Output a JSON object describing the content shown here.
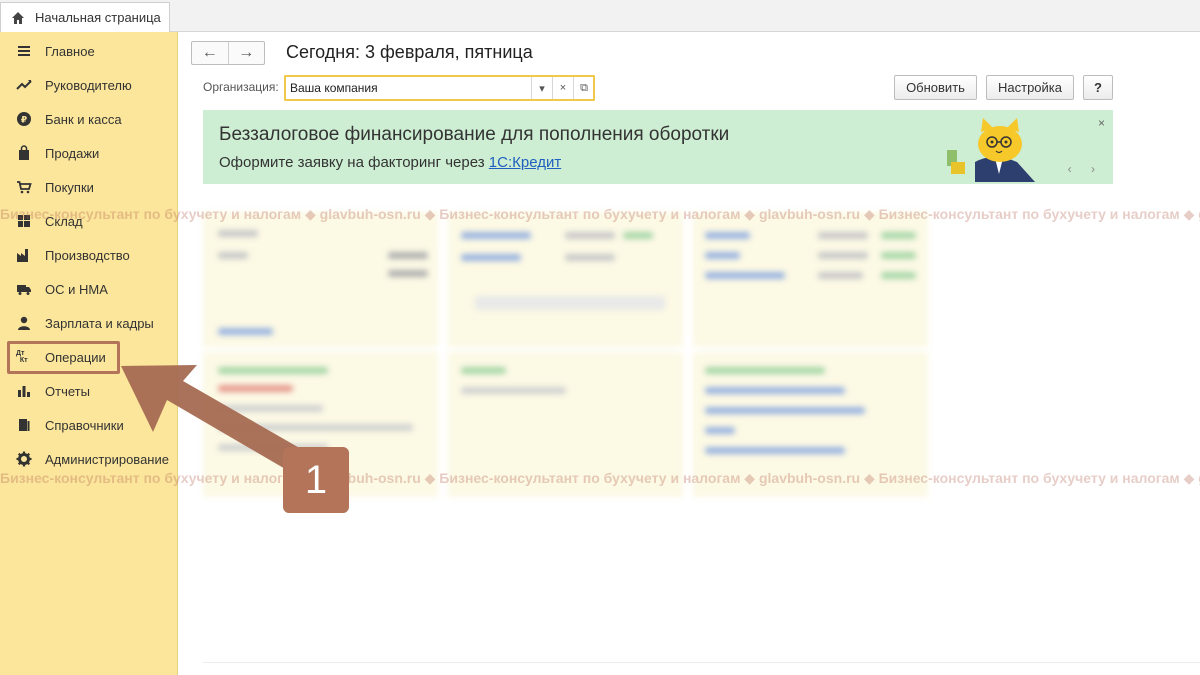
{
  "tabs": {
    "home": "Начальная страница"
  },
  "sidebar": {
    "items": [
      {
        "label": "Главное",
        "icon": "menu-lines-icon"
      },
      {
        "label": "Руководителю",
        "icon": "trend-chart-icon"
      },
      {
        "label": "Банк и касса",
        "icon": "ruble-coin-icon"
      },
      {
        "label": "Продажи",
        "icon": "shopping-bag-icon"
      },
      {
        "label": "Покупки",
        "icon": "cart-icon"
      },
      {
        "label": "Склад",
        "icon": "warehouse-icon"
      },
      {
        "label": "Производство",
        "icon": "factory-icon"
      },
      {
        "label": "ОС и НМА",
        "icon": "truck-icon"
      },
      {
        "label": "Зарплата и кадры",
        "icon": "person-icon"
      },
      {
        "label": "Операции",
        "icon": "dt-kt-icon",
        "icon_text_top": "Дт",
        "icon_text_bottom": "Кт"
      },
      {
        "label": "Отчеты",
        "icon": "bar-chart-icon"
      },
      {
        "label": "Справочники",
        "icon": "books-icon"
      },
      {
        "label": "Администрирование",
        "icon": "gear-icon"
      }
    ]
  },
  "header": {
    "title": "Сегодня: 3 февраля, пятница",
    "back": "←",
    "forward": "→"
  },
  "org": {
    "label": "Организация:",
    "value": "Ваша компания",
    "dropdown": "▾",
    "clear": "×",
    "open": "⧉"
  },
  "toolbar": {
    "refresh": "Обновить",
    "settings": "Настройка",
    "help": "?"
  },
  "banner": {
    "title": "Беззалоговое финансирование для пополнения оборотки",
    "subtitle": "Оформите заявку на факторинг через",
    "link": "1С:Кредит",
    "close": "×",
    "arrows": "‹ ›",
    "bg_color": "#cdeed3"
  },
  "watermark": {
    "text": "Бизнес-консультант по бухучету и налогам ◆ glavbuh-osn.ru ◆ Бизнес-консультант по бухучету и налогам ◆ glavbuh-osn.ru ◆ Бизнес-консультант по бухучету и налогам ◆ glavbuh-osn.ru"
  },
  "callout": {
    "number": "1",
    "color": "#b3745a"
  },
  "colors": {
    "sidebar": "#fbe69b",
    "accent": "#f0c84c",
    "link": "#1f5fbf"
  }
}
